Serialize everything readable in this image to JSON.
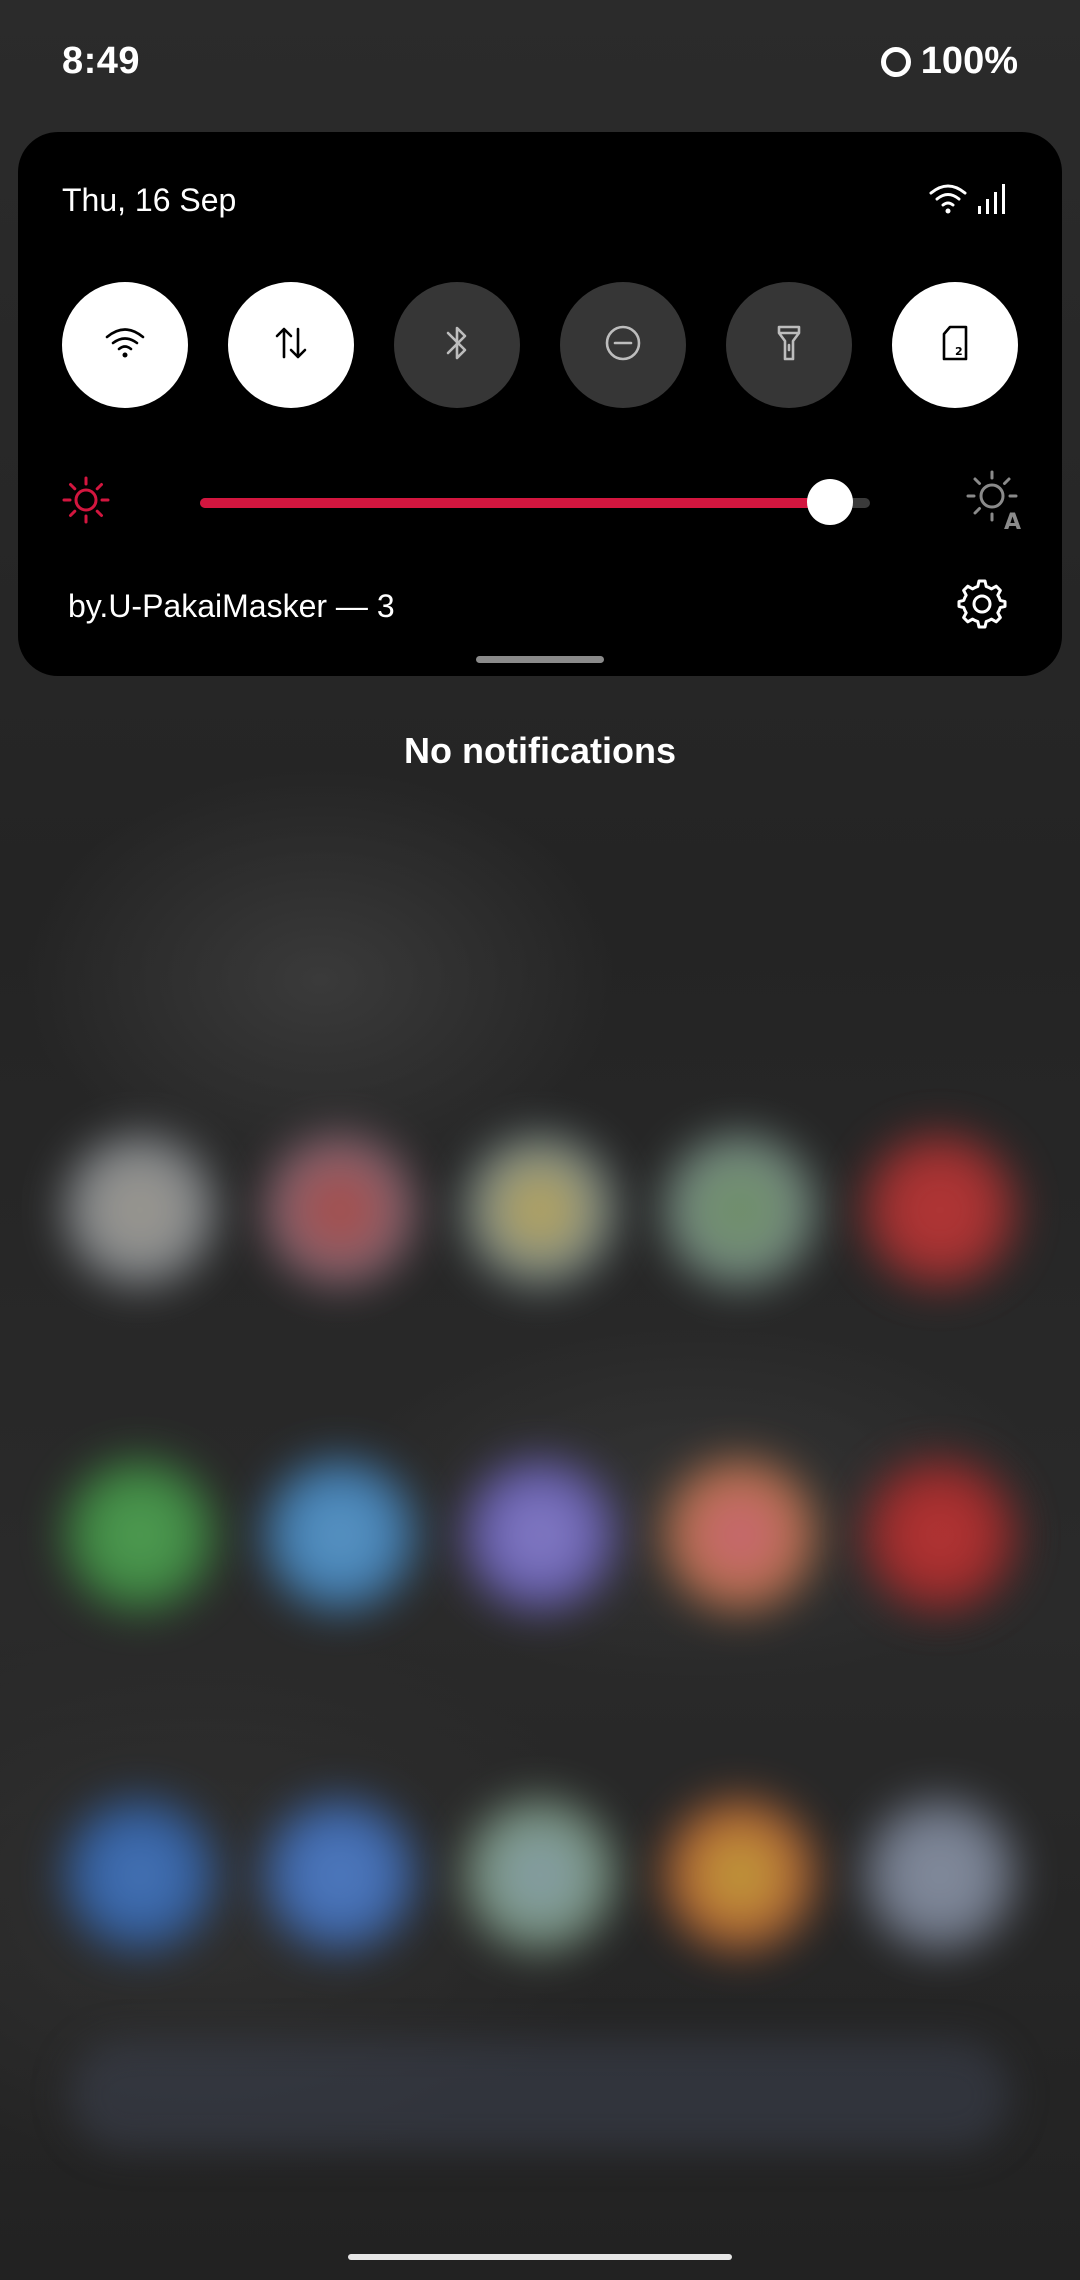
{
  "status_bar": {
    "time": "8:49",
    "battery_percent": "100%",
    "battery_icon": "battery-ring-icon"
  },
  "quick_settings": {
    "date": "Thu, 16 Sep",
    "system_icons": [
      "wifi-icon",
      "signal-icon"
    ],
    "tiles": [
      {
        "name": "wifi",
        "icon": "wifi-icon",
        "state": "on"
      },
      {
        "name": "mobile-data",
        "icon": "data-transfer-icon",
        "state": "on"
      },
      {
        "name": "bluetooth",
        "icon": "bluetooth-icon",
        "state": "off"
      },
      {
        "name": "do-not-disturb",
        "icon": "dnd-icon",
        "state": "off"
      },
      {
        "name": "flashlight",
        "icon": "flashlight-icon",
        "state": "off"
      },
      {
        "name": "sim-card",
        "icon": "sim-card-icon",
        "state": "on"
      }
    ],
    "brightness": {
      "level": 0.94,
      "accent_color": "#d3163f",
      "low_icon": "sun-icon",
      "auto_icon": "auto-brightness-icon"
    },
    "footer_label": "by.U-PakaiMasker — 3",
    "settings_icon": "gear-icon"
  },
  "notifications": {
    "empty_text": "No notifications"
  }
}
